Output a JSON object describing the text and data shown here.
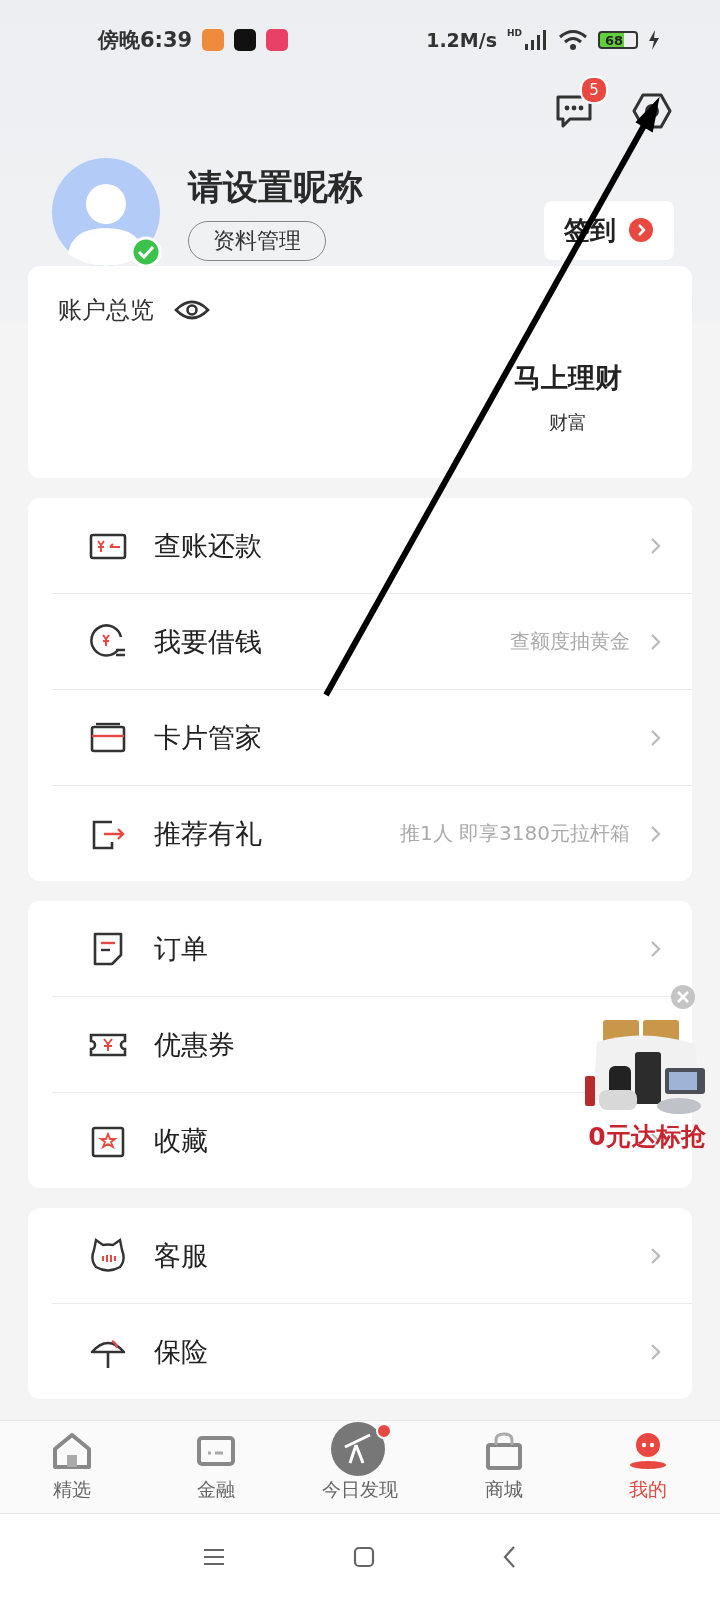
{
  "status_bar": {
    "time": "傍晚6:39",
    "speed": "1.2M/s",
    "network": "HD",
    "battery": "68"
  },
  "header": {
    "message_badge": "5"
  },
  "profile": {
    "nickname": "请设置昵称",
    "manage_button": "资料管理",
    "verified": true,
    "checkin_button": "签到"
  },
  "account": {
    "title": "账户总览",
    "product": "马上理财",
    "product_sub": "财富"
  },
  "menu_groups": [
    {
      "items": [
        {
          "label": "查账还款"
        },
        {
          "label": "我要借钱",
          "hint": "查额度抽黄金"
        },
        {
          "label": "卡片管家"
        },
        {
          "label": "推荐有礼",
          "hint": "推1人 即享3180元拉杆箱"
        }
      ]
    },
    {
      "items": [
        {
          "label": "订单"
        },
        {
          "label": "优惠券"
        },
        {
          "label": "收藏"
        }
      ]
    },
    {
      "items": [
        {
          "label": "客服"
        },
        {
          "label": "保险"
        }
      ]
    }
  ],
  "floating_ad": {
    "caption": "0元达标抢"
  },
  "tabs": [
    {
      "label": "精选",
      "selected": false,
      "dot": false
    },
    {
      "label": "金融",
      "selected": false,
      "dot": false
    },
    {
      "label": "今日发现",
      "selected": false,
      "dot": true
    },
    {
      "label": "商城",
      "selected": false,
      "dot": false
    },
    {
      "label": "我的",
      "selected": true,
      "dot": false
    }
  ]
}
